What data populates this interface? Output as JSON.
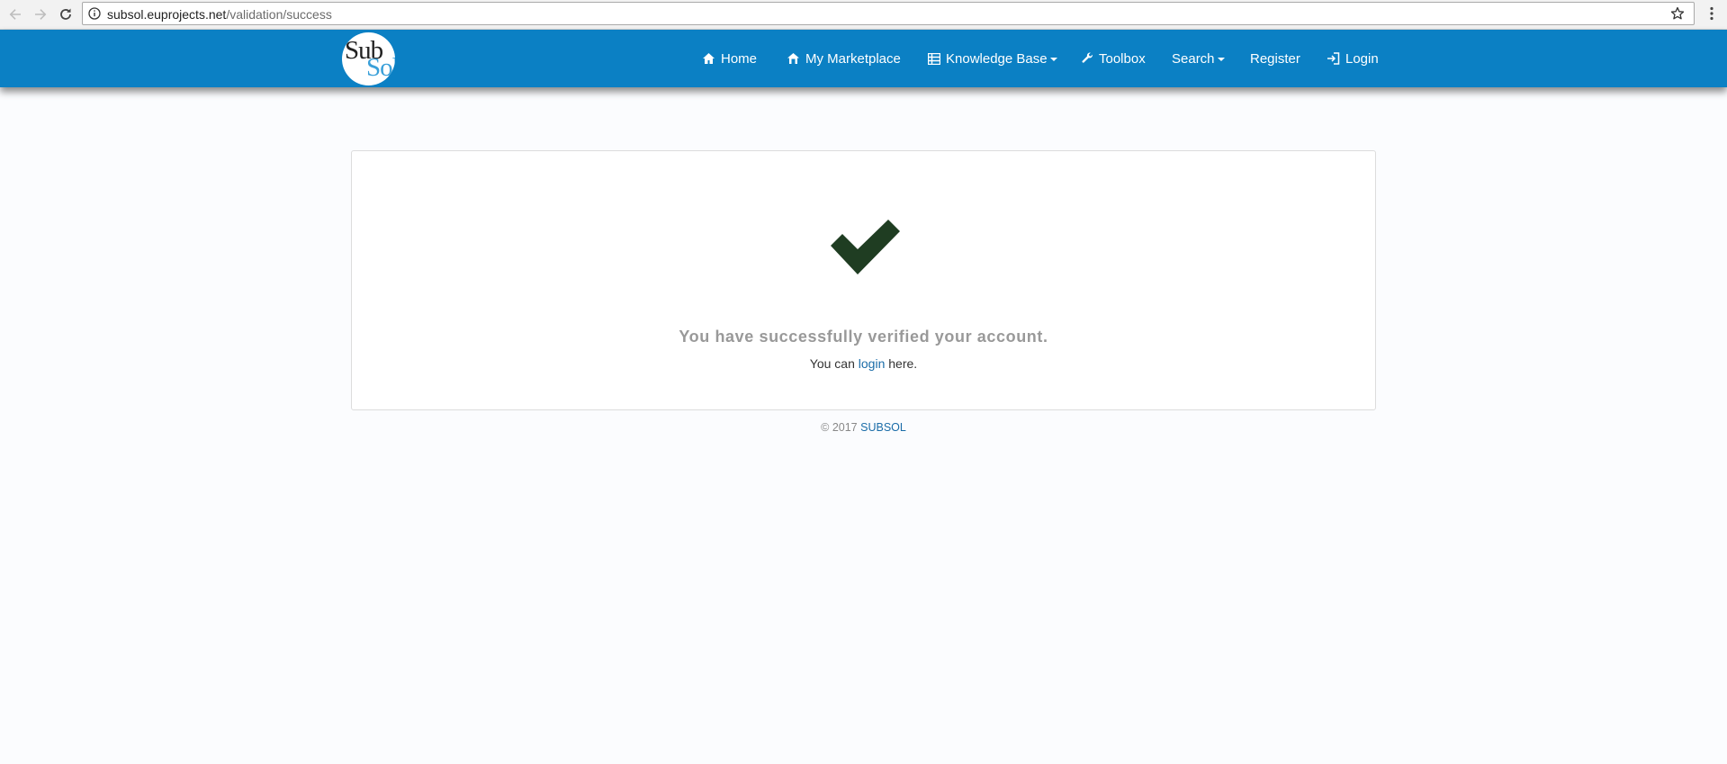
{
  "browser": {
    "url_domain": "subsol.euprojects.net",
    "url_path": "/validation/success",
    "icons": [
      "back-arrow-icon",
      "forward-arrow-icon",
      "reload-icon",
      "info-icon",
      "star-icon",
      "menu-dots-icon"
    ]
  },
  "site": {
    "logo": {
      "part1": "Sub",
      "part2": "Sol"
    },
    "nav": {
      "home": "Home",
      "marketplace": "My Marketplace",
      "knowledge": "Knowledge Base",
      "toolbox": "Toolbox",
      "search": "Search",
      "register": "Register",
      "login": "Login"
    }
  },
  "main": {
    "message": "You have successfully verified your account.",
    "line_prefix": "You can",
    "line_link": "login",
    "line_suffix": "here."
  },
  "footer": {
    "copyright": "© 2017",
    "brand": "SUBSOL"
  },
  "colors": {
    "navbar": "#0b80c4",
    "checkmark": "#1f3d22",
    "link": "#1a6ca8",
    "page_background": "#fbfcfe"
  }
}
